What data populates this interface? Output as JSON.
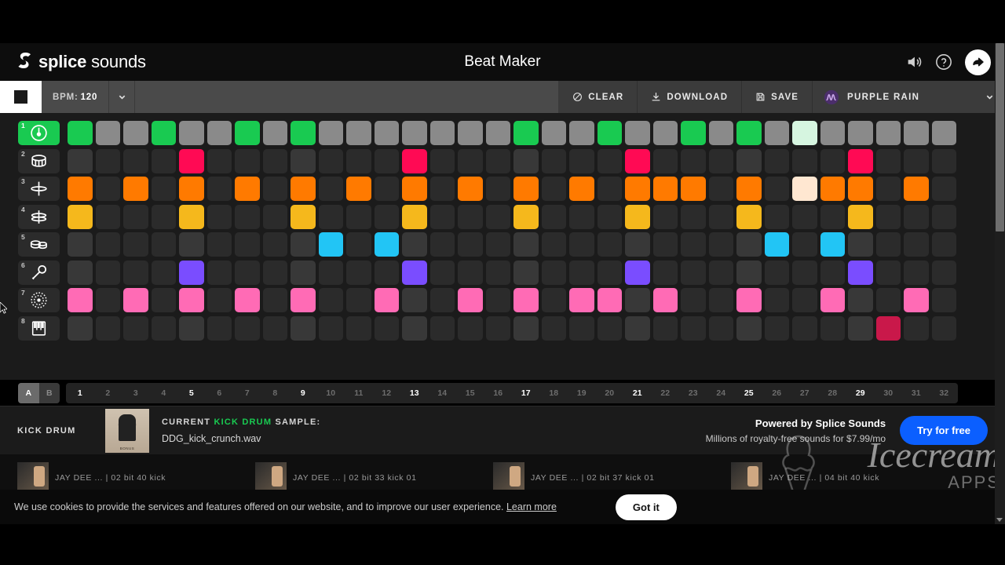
{
  "header": {
    "logo_bold": "splice",
    "logo_light": " sounds",
    "title": "Beat Maker",
    "icons": [
      {
        "name": "volume-icon"
      },
      {
        "name": "help-icon"
      },
      {
        "name": "share-icon"
      }
    ]
  },
  "toolbar": {
    "play_state": "stop",
    "bpm_label": "BPM:",
    "bpm_value": "120",
    "clear_label": "CLEAR",
    "download_label": "DOWNLOAD",
    "save_label": "SAVE",
    "preset_label": "PURPLE RAIN"
  },
  "sequencer": {
    "steps": 32,
    "accent_every": 4,
    "playhead_step": 27,
    "bank_a": "A",
    "bank_b": "B",
    "step_numbers": [
      "1",
      "2",
      "3",
      "4",
      "5",
      "6",
      "7",
      "8",
      "9",
      "10",
      "11",
      "12",
      "13",
      "14",
      "15",
      "16",
      "17",
      "18",
      "19",
      "20",
      "21",
      "22",
      "23",
      "24",
      "25",
      "26",
      "27",
      "28",
      "29",
      "30",
      "31",
      "32"
    ],
    "rows": [
      {
        "num": "1",
        "name": "kick",
        "icon": "kick-drum-icon",
        "color": "#19ca51",
        "selected": true,
        "on_steps": [
          1,
          4,
          7,
          9,
          17,
          20,
          23,
          25,
          27
        ],
        "row_style": "filled"
      },
      {
        "num": "2",
        "name": "snare",
        "icon": "snare-drum-icon",
        "color": "#ff0a54",
        "selected": false,
        "on_steps": [
          5,
          13,
          21,
          29
        ],
        "row_style": "sparse"
      },
      {
        "num": "3",
        "name": "hihat-closed",
        "icon": "hihat-closed-icon",
        "color": "#ff7a00",
        "selected": false,
        "on_steps": [
          1,
          3,
          5,
          7,
          9,
          11,
          13,
          15,
          17,
          19,
          21,
          22,
          23,
          25,
          27,
          28,
          29,
          31
        ],
        "row_style": "sparse"
      },
      {
        "num": "4",
        "name": "hihat-open",
        "icon": "hihat-open-icon",
        "color": "#f5b81c",
        "selected": false,
        "on_steps": [
          1,
          5,
          9,
          13,
          17,
          21,
          25,
          29
        ],
        "row_style": "sparse"
      },
      {
        "num": "5",
        "name": "tom",
        "icon": "toms-icon",
        "color": "#22c5f5",
        "selected": false,
        "on_steps": [
          10,
          12,
          26,
          28
        ],
        "row_style": "sparse"
      },
      {
        "num": "6",
        "name": "vocal",
        "icon": "microphone-icon",
        "color": "#7a4dff",
        "selected": false,
        "on_steps": [
          5,
          13,
          21,
          29
        ],
        "row_style": "sparse"
      },
      {
        "num": "7",
        "name": "percussion",
        "icon": "tambourine-icon",
        "color": "#ff6bb5",
        "selected": false,
        "on_steps": [
          1,
          3,
          5,
          7,
          9,
          12,
          15,
          17,
          19,
          20,
          22,
          25,
          28,
          31
        ],
        "row_style": "sparse"
      },
      {
        "num": "8",
        "name": "melody",
        "icon": "piano-keys-icon",
        "color": "#c9184a",
        "selected": false,
        "on_steps": [
          30
        ],
        "row_style": "sparse"
      }
    ]
  },
  "sample_bar": {
    "track_label": "KICK DRUM",
    "current_prefix": "CURRENT ",
    "current_highlight": "KICK DRUM",
    "current_suffix": " SAMPLE:",
    "filename": "DDG_kick_crunch.wav",
    "thumb_caption": "BONUS",
    "promo_line1": "Powered by Splice Sounds",
    "promo_line2": "Millions of royalty-free sounds for $7.99/mo",
    "cta_label": "Try for free"
  },
  "packs": [
    {
      "text": "JAY DEE ... | 02 bit 40 kick"
    },
    {
      "text": "JAY DEE ... | 02 bit 33 kick 01"
    },
    {
      "text": "JAY DEE ... | 02 bit 37 kick 01"
    },
    {
      "text": "JAY DEE ... | 04 bit 40 kick"
    }
  ],
  "cookie": {
    "message": "We use cookies to provide the services and features offered on our website, and to improve our user experience.",
    "learn_more": "Learn more",
    "accept_label": "Got it"
  },
  "watermark": {
    "line1": "Icecream",
    "line2": "APPS"
  },
  "colors": {
    "accent_green": "#19ca51",
    "cta_blue": "#0b5fff",
    "toolbar_bg": "#4a4a4a",
    "grid_bg": "#1b1b1b"
  }
}
